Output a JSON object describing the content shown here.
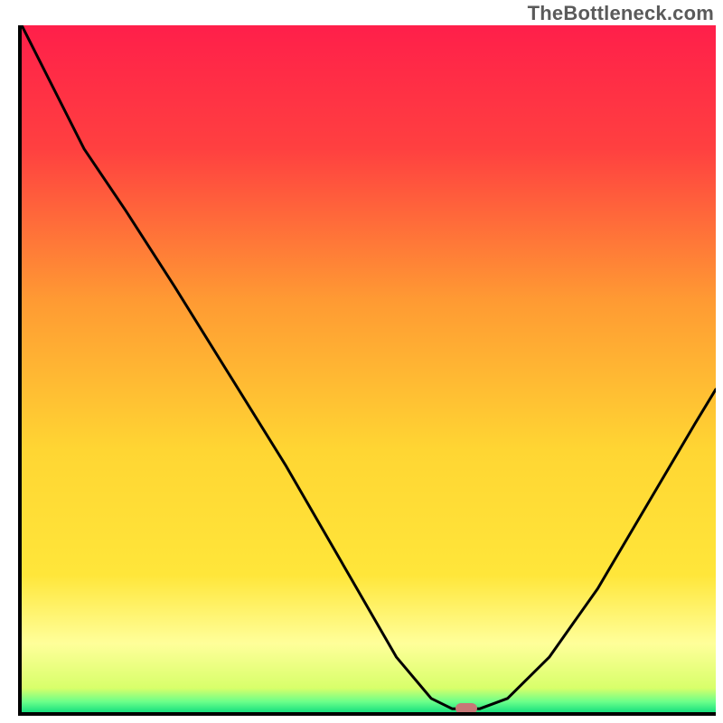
{
  "attribution": "TheBottleneck.com",
  "colors": {
    "top_red": "#ff1f4a",
    "mid_orange": "#ff8a33",
    "yellow": "#ffe63a",
    "pale_yellow": "#ffff9a",
    "green": "#18e07f",
    "axis": "#000000",
    "curve": "#000000",
    "marker": "#c77777"
  },
  "chart_data": {
    "type": "line",
    "title": "",
    "xlabel": "",
    "ylabel": "",
    "x": [
      0.0,
      0.04,
      0.09,
      0.15,
      0.22,
      0.3,
      0.38,
      0.46,
      0.54,
      0.59,
      0.62,
      0.66,
      0.7,
      0.76,
      0.83,
      0.9,
      0.97,
      1.0
    ],
    "values": [
      1.0,
      0.92,
      0.82,
      0.73,
      0.62,
      0.49,
      0.36,
      0.22,
      0.08,
      0.02,
      0.005,
      0.005,
      0.02,
      0.08,
      0.18,
      0.3,
      0.42,
      0.47
    ],
    "xlim": [
      0,
      1
    ],
    "ylim": [
      0,
      1
    ],
    "marker": {
      "x": 0.64,
      "y": 0.005
    },
    "gradient_stops": [
      {
        "pos": 0.0,
        "color": "#ff1f4a"
      },
      {
        "pos": 0.18,
        "color": "#ff4040"
      },
      {
        "pos": 0.4,
        "color": "#ff9a33"
      },
      {
        "pos": 0.62,
        "color": "#ffd633"
      },
      {
        "pos": 0.8,
        "color": "#ffe63a"
      },
      {
        "pos": 0.9,
        "color": "#ffff9a"
      },
      {
        "pos": 0.965,
        "color": "#d8ff6a"
      },
      {
        "pos": 0.985,
        "color": "#6aff8a"
      },
      {
        "pos": 1.0,
        "color": "#18e07f"
      }
    ]
  }
}
